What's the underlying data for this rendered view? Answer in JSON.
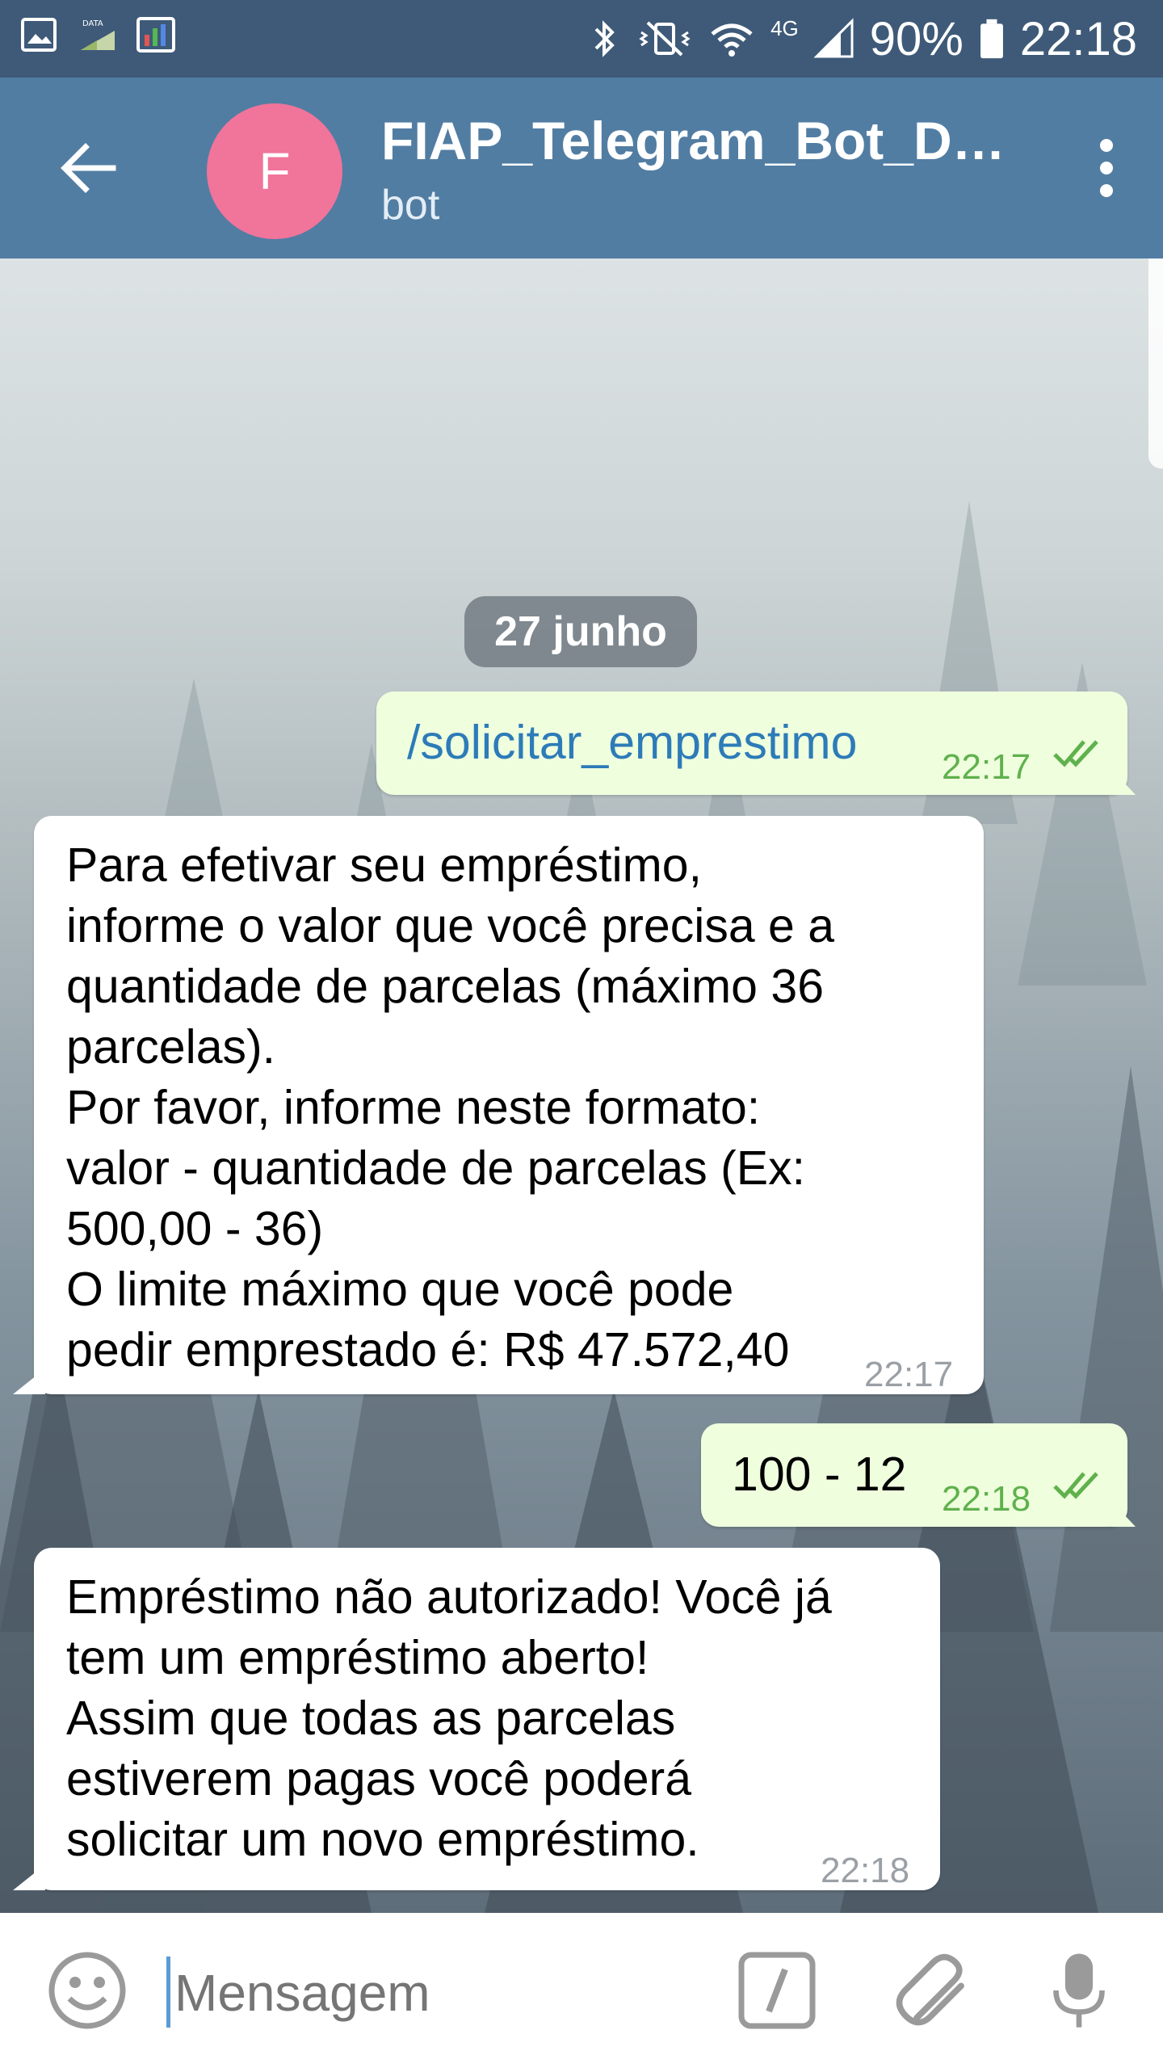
{
  "status_bar": {
    "battery": "90%",
    "time": "22:18",
    "network": "4G"
  },
  "header": {
    "avatar_letter": "F",
    "title": "FIAP_Telegram_Bot_D…",
    "subtitle": "bot"
  },
  "chat": {
    "date_separator": "27 junho",
    "messages": [
      {
        "direction": "out",
        "text": "/solicitar_emprestimo",
        "time": "22:17",
        "status": "read"
      },
      {
        "direction": "in",
        "lines": [
          "Para efetivar seu empréstimo,",
          "informe o valor que você precisa e a",
          "quantidade de parcelas (máximo 36",
          "parcelas).",
          "Por favor, informe neste formato:",
          "valor - quantidade de parcelas (Ex:",
          "500,00 - 36)",
          "O limite máximo que você pode",
          "pedir emprestado é: R$ 47.572,40"
        ],
        "time": "22:17"
      },
      {
        "direction": "out",
        "text": "100 - 12",
        "time": "22:18",
        "status": "read"
      },
      {
        "direction": "in",
        "lines": [
          "Empréstimo não autorizado! Você já",
          "tem um empréstimo aberto!",
          "Assim que todas as parcelas",
          "estiverem pagas você poderá",
          "solicitar um novo empréstimo."
        ],
        "time": "22:18"
      }
    ]
  },
  "input": {
    "placeholder": "Mensagem"
  },
  "colors": {
    "header": "#527da3",
    "status_bar": "#3e5a78",
    "outgoing_bubble": "#efffde",
    "incoming_bubble": "#ffffff",
    "command_link": "#2d7bb8",
    "read_check": "#5fb14c",
    "avatar": "#f1749a"
  }
}
